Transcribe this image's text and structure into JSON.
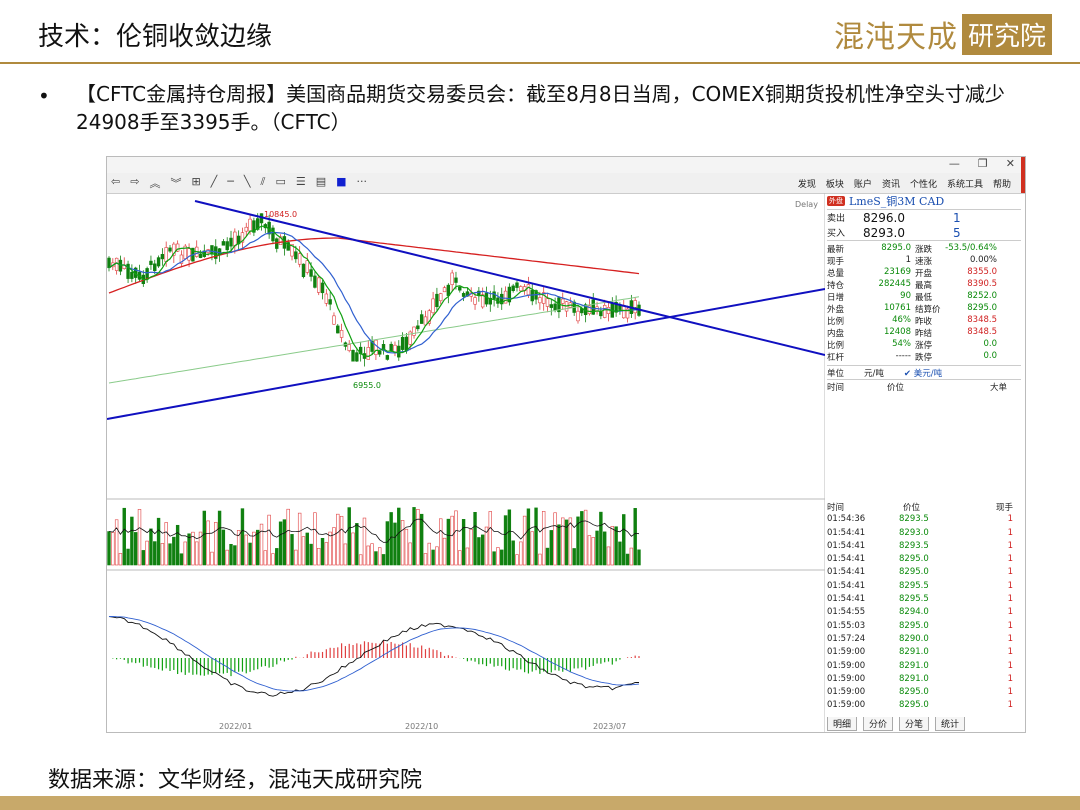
{
  "slide": {
    "title": "技术：伦铜收敛边缘",
    "logo_text": "混沌天成",
    "logo_box": "研究院",
    "bullet_dot": "•",
    "bullet": "【CFTC金属持仓周报】美国商品期货交易委员会：截至8月8日当周，COMEX铜期货投机性净空头寸减少24908手至3395手。（CFTC）",
    "source": "数据来源：文华财经，混沌天成研究院"
  },
  "app": {
    "window_buttons": [
      "—",
      "❐",
      "✕"
    ],
    "menu": [
      "发现",
      "板块",
      "账户",
      "资讯",
      "个性化",
      "系统工具",
      "帮助"
    ],
    "chart": {
      "delay_label": "Delay",
      "high_label": "10845.0",
      "low_label": "6955.0",
      "x_labels": [
        "2022/01",
        "2022/10",
        "2023/07"
      ]
    },
    "quote": {
      "tag": "外盘",
      "symbol": "LmeS_铜3M  CAD",
      "ask_label": "卖出",
      "ask_price": "8296.0",
      "ask_qty": "1",
      "bid_label": "买入",
      "bid_price": "8293.0",
      "bid_qty": "5",
      "rows": [
        [
          "最新",
          "8295.0",
          "涨跌",
          "-53.5/0.64%"
        ],
        [
          "现手",
          "1",
          "速涨",
          "0.00%"
        ],
        [
          "总量",
          "23169",
          "开盘",
          "8355.0"
        ],
        [
          "持仓",
          "282445",
          "最高",
          "8390.5"
        ],
        [
          "日增",
          "90",
          "最低",
          "8252.0"
        ],
        [
          "外盘",
          "10761",
          "结算价",
          "8295.0"
        ],
        [
          "比例",
          "46%",
          "昨收",
          "8348.5"
        ],
        [
          "内盘",
          "12408",
          "昨结",
          "8348.5"
        ],
        [
          "比例",
          "54%",
          "涨停",
          "0.0"
        ],
        [
          "杠杆",
          "-----",
          "跌停",
          "0.0"
        ]
      ],
      "unit_label": "单位",
      "unit_value": "元/吨",
      "unit_option": "✔ 美元/吨",
      "list_headers": [
        "时间",
        "价位",
        "大单"
      ]
    },
    "ticks": {
      "headers": [
        "时间",
        "价位",
        "现手"
      ],
      "rows": [
        [
          "01:54:36",
          "8293.5",
          "1"
        ],
        [
          "01:54:41",
          "8293.0",
          "1"
        ],
        [
          "01:54:41",
          "8293.5",
          "1"
        ],
        [
          "01:54:41",
          "8295.0",
          "1"
        ],
        [
          "01:54:41",
          "8295.0",
          "1"
        ],
        [
          "01:54:41",
          "8295.5",
          "1"
        ],
        [
          "01:54:41",
          "8295.5",
          "1"
        ],
        [
          "01:54:55",
          "8294.0",
          "1"
        ],
        [
          "01:55:03",
          "8295.0",
          "1"
        ],
        [
          "01:57:24",
          "8290.0",
          "1"
        ],
        [
          "01:59:00",
          "8291.0",
          "1"
        ],
        [
          "01:59:00",
          "8291.0",
          "1"
        ],
        [
          "01:59:00",
          "8291.0",
          "1"
        ],
        [
          "01:59:00",
          "8295.0",
          "1"
        ],
        [
          "01:59:00",
          "8295.0",
          "1"
        ]
      ],
      "tabs": [
        "明细",
        "分价",
        "分笔",
        "统计"
      ]
    }
  }
}
